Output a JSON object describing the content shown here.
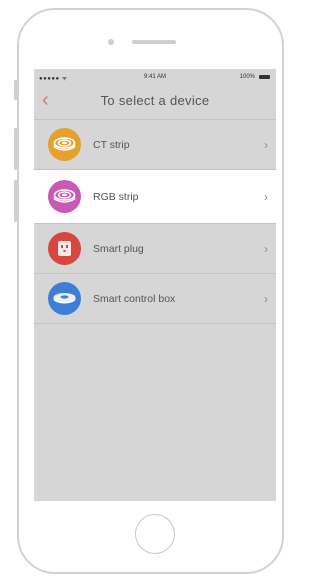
{
  "status": {
    "carrier": "●●●●● ᯤ",
    "time": "9:41 AM",
    "battery_pct": "100%"
  },
  "nav": {
    "title": "To select a device",
    "back_glyph": "‹"
  },
  "devices": [
    {
      "label": "CT strip",
      "color": "#e6a12c",
      "icon": "ct-strip-icon"
    },
    {
      "label": "RGB strip",
      "color": "#c859b6",
      "icon": "rgb-strip-icon"
    },
    {
      "label": "Smart plug",
      "color": "#d9453f",
      "icon": "smart-plug-icon"
    },
    {
      "label": "Smart control box",
      "color": "#3e7fd6",
      "icon": "smart-control-box-icon"
    }
  ],
  "chevron": "›",
  "colors": {
    "accent": "#e0735a",
    "selected_row": "#ffffff",
    "screen_bg": "#d6d6d6"
  }
}
